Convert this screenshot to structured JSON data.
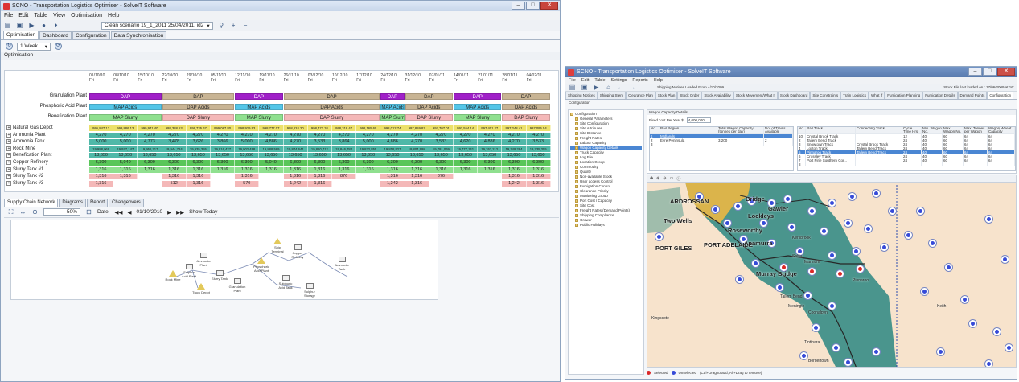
{
  "win1": {
    "title": "SCNO - Transportation Logistics Optimiser - SolveIT Software",
    "menu": [
      "File",
      "Edit",
      "Table",
      "View",
      "Optimisation",
      "Help"
    ],
    "scenario": "Clean scenario 19_1_2011 25/04/2011, id2",
    "tabs": [
      "Optimisation",
      "Dashboard",
      "Configuration",
      "Data Synchronisation"
    ],
    "period": "1 Week",
    "section": "Optimisation",
    "dates": [
      {
        "d": "01/10/10",
        "w": "Fri"
      },
      {
        "d": "08/10/10",
        "w": "Fri"
      },
      {
        "d": "15/10/10",
        "w": "Fri"
      },
      {
        "d": "22/10/10",
        "w": "Fri"
      },
      {
        "d": "29/10/10",
        "w": "Fri"
      },
      {
        "d": "05/11/10",
        "w": "Fri"
      },
      {
        "d": "12/11/10",
        "w": "Fri"
      },
      {
        "d": "19/11/10",
        "w": "Fri"
      },
      {
        "d": "26/11/10",
        "w": "Fri"
      },
      {
        "d": "03/12/10",
        "w": "Fri"
      },
      {
        "d": "10/12/10",
        "w": "Fri"
      },
      {
        "d": "17/12/10",
        "w": "Fri"
      },
      {
        "d": "24/12/10",
        "w": "Fri"
      },
      {
        "d": "31/12/10",
        "w": "Fri"
      },
      {
        "d": "07/01/11",
        "w": "Fri"
      },
      {
        "d": "14/01/11",
        "w": "Fri"
      },
      {
        "d": "21/01/11",
        "w": "Fri"
      },
      {
        "d": "28/01/11",
        "w": "Fri"
      },
      {
        "d": "04/02/11",
        "w": "Fri"
      }
    ],
    "plants": [
      {
        "name": "Granulation Plant",
        "bars": [
          {
            "label": "DAP",
            "start": 0,
            "span": 3,
            "color": "#a020c8"
          },
          {
            "label": "DAP",
            "start": 3,
            "span": 3,
            "color": "#c8b494"
          },
          {
            "label": "DAP",
            "start": 6,
            "span": 2,
            "color": "#a020c8"
          },
          {
            "label": "DAP",
            "start": 8,
            "span": 4,
            "color": "#c8b494"
          },
          {
            "label": "DAP",
            "start": 12,
            "span": 1,
            "color": "#a020c8"
          },
          {
            "label": "DAP",
            "start": 13,
            "span": 2,
            "color": "#c8b494"
          },
          {
            "label": "DAP",
            "start": 15,
            "span": 2,
            "color": "#a020c8"
          },
          {
            "label": "DAP",
            "start": 17,
            "span": 2,
            "color": "#c8b494"
          }
        ]
      },
      {
        "name": "Phosphoric Acid Plant",
        "bars": [
          {
            "label": "MAP Acids",
            "start": 0,
            "span": 3,
            "color": "#54c6e8"
          },
          {
            "label": "DAP Acids",
            "start": 3,
            "span": 3,
            "color": "#c8b494"
          },
          {
            "label": "MAP Acids",
            "start": 6,
            "span": 2,
            "color": "#54c6e8"
          },
          {
            "label": "DAP Acids",
            "start": 8,
            "span": 4,
            "color": "#c8b494"
          },
          {
            "label": "MAP Acids",
            "start": 12,
            "span": 1,
            "color": "#54c6e8"
          },
          {
            "label": "DAP Acids",
            "start": 13,
            "span": 2,
            "color": "#c8b494"
          },
          {
            "label": "MAP Acids",
            "start": 15,
            "span": 2,
            "color": "#54c6e8"
          },
          {
            "label": "DAP Acids",
            "start": 17,
            "span": 2,
            "color": "#c8b494"
          }
        ]
      },
      {
        "name": "Benefication Plant",
        "bars": [
          {
            "label": "MAP Slurry",
            "start": 0,
            "span": 3,
            "color": "#8fe08f"
          },
          {
            "label": "DAP Slurry",
            "start": 3,
            "span": 3,
            "color": "#f4b8b8"
          },
          {
            "label": "MAP Slurry",
            "start": 6,
            "span": 2,
            "color": "#8fe08f"
          },
          {
            "label": "DAP Slurry",
            "start": 8,
            "span": 4,
            "color": "#f4b8b8"
          },
          {
            "label": "MAP Slurry",
            "start": 12,
            "span": 1,
            "color": "#8fe08f"
          },
          {
            "label": "DAP Slurry",
            "start": 13,
            "span": 2,
            "color": "#f4b8b8"
          },
          {
            "label": "MAP Slurry",
            "start": 15,
            "span": 2,
            "color": "#8fe08f"
          },
          {
            "label": "DAP Slurry",
            "start": 17,
            "span": 2,
            "color": "#f4b8b8"
          }
        ]
      }
    ],
    "resources": [
      {
        "name": "Natural Gas Depot",
        "color": "#ece06a",
        "values": [
          "995,847.13",
          "999,886.13",
          "999,941.40",
          "999,388.53",
          "999,735.67",
          "999,087.80",
          "998,929.93",
          "998,777.07",
          "998,624.20",
          "998,471.34",
          "998,318.47",
          "998,165.60",
          "998,012.74",
          "997,859.87",
          "997,707.01",
          "997,554.14",
          "997,401.27",
          "997,248.41",
          "997,095.54"
        ]
      },
      {
        "name": "Ammonia Plant",
        "color": "#4fb8a8",
        "values": [
          "4,270",
          "4,270",
          "4,270",
          "4,270",
          "4,270",
          "4,270",
          "4,270",
          "4,270",
          "4,270",
          "4,270",
          "4,270",
          "4,270",
          "4,270",
          "4,270",
          "4,270",
          "4,270",
          "4,270",
          "4,270",
          "4,270"
        ]
      },
      {
        "name": "Ammonia Tank",
        "color": "#4fb8a8",
        "values": [
          "5,000",
          "5,000",
          "4,773",
          "3,478",
          "3,626",
          "3,866",
          "5,000",
          "4,886",
          "4,270",
          "3,533",
          "3,864",
          "5,000",
          "4,886",
          "4,270",
          "3,533",
          "4,620",
          "4,886",
          "4,270",
          "3,533"
        ]
      },
      {
        "name": "Rock Mine",
        "color": "#4fb8a8",
        "values": [
          "19,988,069",
          "19,977,147",
          "19,956,717",
          "19,944,784",
          "19,935,355",
          "19,916,427",
          "19,902,498",
          "19,888,569",
          "19,874,641",
          "19,860,712",
          "19,846,784",
          "19,832,855",
          "19,818,927",
          "19,804,998",
          "19,791,069",
          "19,777,141",
          "19,763,212",
          "19,749,284",
          "19,735,355"
        ]
      },
      {
        "name": "Benefication Plant",
        "color": "#4fb8a8",
        "values": [
          "13,650",
          "13,650",
          "13,650",
          "13,650",
          "13,650",
          "13,650",
          "13,650",
          "13,650",
          "13,650",
          "13,650",
          "13,650",
          "13,650",
          "13,650",
          "13,650",
          "13,650",
          "13,650",
          "13,650",
          "13,650",
          "13,650"
        ]
      },
      {
        "name": "Copper Refinery",
        "color": "#59c659",
        "values": [
          "6,300",
          "5,040",
          "6,300",
          "6,300",
          "6,300",
          "6,300",
          "6,300",
          "5,040",
          "6,300",
          "6,300",
          "6,300",
          "6,300",
          "6,300",
          "6,300",
          "6,300",
          "6,300",
          "6,300",
          "6,300",
          "6,300"
        ]
      },
      {
        "name": "Slurry Tank #1",
        "color": "#8fe08f",
        "values": [
          "1,316",
          "1,316",
          "1,316",
          "1,316",
          "1,316",
          "1,316",
          "1,316",
          "1,316",
          "1,316",
          "1,316",
          "1,316",
          "1,316",
          "1,316",
          "1,316",
          "1,316",
          "1,316",
          "1,316",
          "1,316",
          "1,316"
        ]
      },
      {
        "name": "Slurry Tank #2",
        "color": "#f4b8b8",
        "values": [
          "1,316",
          "1,316",
          "",
          "1,316",
          "1,316",
          "",
          "1,316",
          "",
          "1,316",
          "1,316",
          "876",
          "",
          "1,316",
          "1,316",
          "876",
          "",
          "",
          "1,316",
          "1,316"
        ]
      },
      {
        "name": "Slurry Tank #3",
        "color": "#f4b8b8",
        "values": [
          "1,316",
          "",
          "",
          "512",
          "1,316",
          "",
          "570",
          "",
          "1,242",
          "1,316",
          "",
          "",
          "1,242",
          "1,316",
          "",
          "",
          "",
          "1,242",
          "1,316"
        ]
      }
    ],
    "bottom": {
      "tabs": [
        "Supply Chain Network",
        "Diagrams",
        "Report",
        "Changeovers"
      ],
      "zoom": "50%",
      "date_label": "Date:",
      "date": "01/10/2010",
      "show_today": "Show Today",
      "nodes": [
        {
          "label": "Rock Mine"
        },
        {
          "label": "Sulphur Acid Plant"
        },
        {
          "label": "Ammonia Plant"
        },
        {
          "label": "Ship Terminal"
        },
        {
          "label": "Slurry Tank"
        },
        {
          "label": "Granulation Plant"
        },
        {
          "label": "Phosphoric Acid Plant"
        },
        {
          "label": "Sulphuric Acid Tank"
        },
        {
          "label": "Copper Refinery"
        },
        {
          "label": "Truck Depot"
        },
        {
          "label": "Sulphur Storage"
        },
        {
          "label": "Ammonia Tank"
        }
      ]
    }
  },
  "win2": {
    "title": "SCNO - Transportation Logistics Optimiser - SolveIT Software",
    "menu": [
      "File",
      "Edit",
      "Table",
      "Settings",
      "Reports",
      "Help"
    ],
    "status": "Stock File last loaded on : 17/06/2009 at 16:",
    "shipping": "Shipping Notices Loaded From 4/10/2009",
    "tabs": [
      "Shipping Notices",
      "Shipping Stem",
      "Clearance Plan",
      "Stock Plan",
      "Stock Order",
      "Stock Availability",
      "Stock Movement/What If",
      "Stock Dashboard",
      "Site Constraints",
      "Train Logistics",
      "What If",
      "Fumigation Planning",
      "Fumigation Details",
      "Demand Points",
      "Configuration"
    ],
    "subtab": "Configuration",
    "tree": [
      "Configuration",
      "General Parameters",
      "Site Configuration",
      "Site Attributes",
      "Site Distance",
      "Freight Rates",
      "Labour Capacity",
      "Wagon Capacity Details",
      "Truck Capacity",
      "Log File",
      "Location Group",
      "Commodity",
      "Quality",
      "Non-available Stock",
      "User access Control",
      "Fumigation Control",
      "Clearance Priority",
      "Monitoring Group",
      "Port Cost / Capacity",
      "Site Cost",
      "Freight Rates (Demand Points)",
      "Shipping Compliance",
      "Grower",
      "Public Holidays"
    ],
    "tree_selected": 7,
    "wagon_title": "Wagon Capacity Details",
    "fixed_cost_label": "Fixed cost Per Year $",
    "fixed_cost": "4,000,000",
    "left_headers": [
      "No.",
      "Rail Region",
      "Total Wagon Capacity (tonnes per day)",
      "No. of Trains Available"
    ],
    "left_rows": [
      [
        "1",
        "Midlands",
        "",
        ""
      ],
      [
        "2",
        "Eyre Peninsula",
        "3,200",
        "2"
      ],
      [
        "3",
        "",
        "",
        ""
      ]
    ],
    "right_headers": [
      "No.",
      "Rail Track",
      "Connecting Track",
      "Cycle Time Hrs",
      "Min. Wagon No.",
      "Max. Wagon No.",
      "Max. Tonnes per Wagon",
      "Wagon Wheat Capacity"
    ],
    "right_rows": [
      [
        "10",
        "Crystal Brook Track",
        "",
        "12",
        "40",
        "60",
        "64",
        "64"
      ],
      [
        "2",
        "Tailem Bend Track",
        "",
        "24",
        "40",
        "60",
        "64",
        "64"
      ],
      [
        "3",
        "Snowtown Track",
        "Crystal Brook Track",
        "24",
        "40",
        "60",
        "64",
        "64"
      ],
      [
        "4",
        "Loxton Track",
        "Tailem Bend Track",
        "24",
        "40",
        "60",
        "64",
        "64"
      ],
      [
        "5",
        "Pinnaroo Track",
        "Tailem Bend Track",
        "24",
        "40",
        "60",
        "64",
        "64"
      ],
      [
        "6",
        "Crossley Track",
        "",
        "24",
        "40",
        "60",
        "64",
        "64"
      ],
      [
        "7",
        "Port Pirie Southern Cor...",
        "",
        "24",
        "40",
        "60",
        "64",
        "64"
      ],
      [
        "8",
        "",
        "",
        "",
        "",
        "",
        "",
        ""
      ]
    ],
    "right_selected": 4,
    "map_labels": [
      "ARDROSSAN",
      "Two Wells",
      "Bridge",
      "Gawler",
      "Lockleys",
      "Roseworthy",
      "PORT ADELAIDE",
      "Apamurra",
      "Kersbrook",
      "PORT GILES",
      "Saltia",
      "Mannum",
      "Murray Bridge",
      "Tailem Bend",
      "Pinnaroo",
      "Coonalpyn",
      "Meningie",
      "Keith",
      "Bordertown",
      "Tintinara",
      "Kingscote"
    ],
    "legend_selected": "Selected",
    "legend_unselected": "Unselected",
    "legend_hint": "(Ctrl+Drag to add, Alt+Drag to remove)",
    "colors": {
      "sea": "#f7e2c9",
      "land": "#3f8f86",
      "land2": "#d9b040"
    }
  }
}
